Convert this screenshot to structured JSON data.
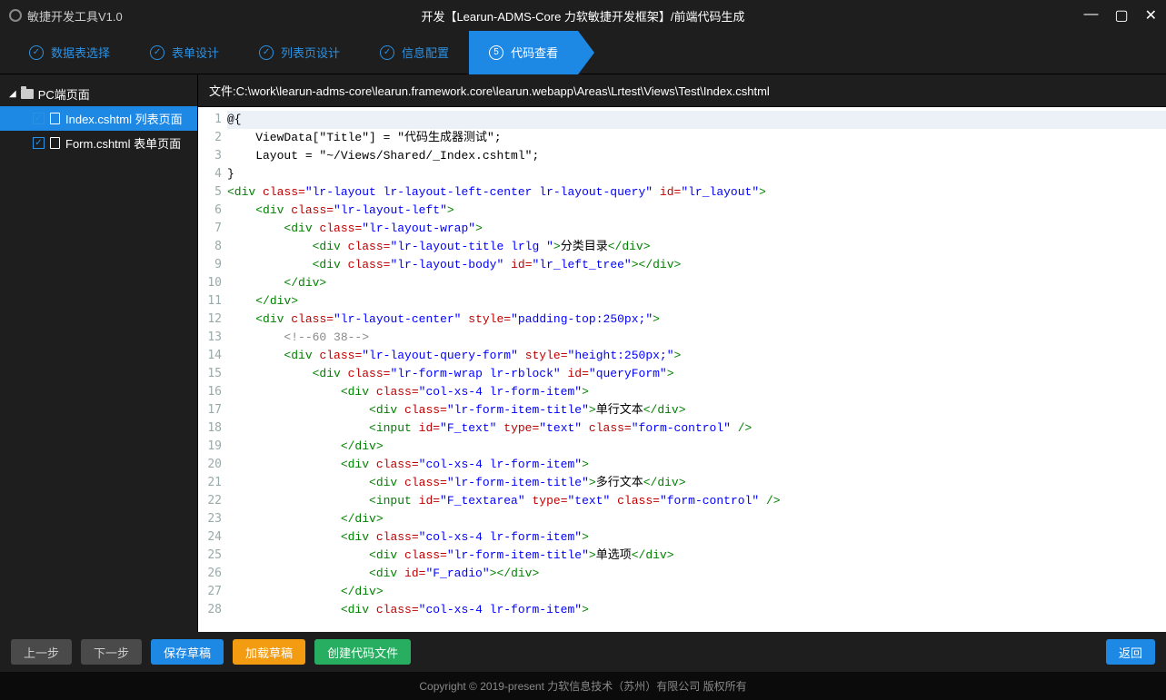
{
  "app": {
    "name": "敏捷开发工具V1.0"
  },
  "window": {
    "title": "开发【Learun-ADMS-Core 力软敏捷开发框架】/前端代码生成"
  },
  "steps": [
    {
      "num": "✓",
      "label": "数据表选择"
    },
    {
      "num": "✓",
      "label": "表单设计"
    },
    {
      "num": "✓",
      "label": "列表页设计"
    },
    {
      "num": "✓",
      "label": "信息配置"
    },
    {
      "num": "⑤",
      "label": "代码查看",
      "active": true
    }
  ],
  "tree": {
    "root": "PC端页面",
    "items": [
      {
        "label": "Index.cshtml 列表页面",
        "selected": true
      },
      {
        "label": "Form.cshtml 表单页面",
        "selected": false
      }
    ]
  },
  "filepath_label": "文件:",
  "filepath": "C:\\work\\learun-adms-core\\learun.framework.core\\learun.webapp\\Areas\\Lrtest\\Views\\Test\\Index.cshtml",
  "code_lines": [
    {
      "n": 1,
      "hl": true,
      "raw": "@{"
    },
    {
      "n": 2,
      "raw": "    ViewData[\"Title\"] = \"代码生成器测试\";"
    },
    {
      "n": 3,
      "raw": "    Layout = \"~/Views/Shared/_Index.cshtml\";"
    },
    {
      "n": 4,
      "raw": "}"
    },
    {
      "n": 5,
      "tokens": [
        [
          "tag",
          "<div "
        ],
        [
          "attr",
          "class="
        ],
        [
          "val",
          "\"lr-layout lr-layout-left-center lr-layout-query\""
        ],
        [
          "txt",
          " "
        ],
        [
          "attr",
          "id="
        ],
        [
          "val",
          "\"lr_layout\""
        ],
        [
          "tag",
          ">"
        ]
      ]
    },
    {
      "n": 6,
      "tokens": [
        [
          "txt",
          "    "
        ],
        [
          "tag",
          "<div "
        ],
        [
          "attr",
          "class="
        ],
        [
          "val",
          "\"lr-layout-left\""
        ],
        [
          "tag",
          ">"
        ]
      ]
    },
    {
      "n": 7,
      "tokens": [
        [
          "txt",
          "        "
        ],
        [
          "tag",
          "<div "
        ],
        [
          "attr",
          "class="
        ],
        [
          "val",
          "\"lr-layout-wrap\""
        ],
        [
          "tag",
          ">"
        ]
      ]
    },
    {
      "n": 8,
      "tokens": [
        [
          "txt",
          "            "
        ],
        [
          "tag",
          "<div "
        ],
        [
          "attr",
          "class="
        ],
        [
          "val",
          "\"lr-layout-title lrlg \""
        ],
        [
          "tag",
          ">"
        ],
        [
          "txt",
          "分类目录"
        ],
        [
          "tag",
          "</div>"
        ]
      ]
    },
    {
      "n": 9,
      "tokens": [
        [
          "txt",
          "            "
        ],
        [
          "tag",
          "<div "
        ],
        [
          "attr",
          "class="
        ],
        [
          "val",
          "\"lr-layout-body\""
        ],
        [
          "txt",
          " "
        ],
        [
          "attr",
          "id="
        ],
        [
          "val",
          "\"lr_left_tree\""
        ],
        [
          "tag",
          "></div>"
        ]
      ]
    },
    {
      "n": 10,
      "tokens": [
        [
          "txt",
          "        "
        ],
        [
          "tag",
          "</div>"
        ]
      ]
    },
    {
      "n": 11,
      "tokens": [
        [
          "txt",
          "    "
        ],
        [
          "tag",
          "</div>"
        ]
      ]
    },
    {
      "n": 12,
      "tokens": [
        [
          "txt",
          "    "
        ],
        [
          "tag",
          "<div "
        ],
        [
          "attr",
          "class="
        ],
        [
          "val",
          "\"lr-layout-center\""
        ],
        [
          "txt",
          " "
        ],
        [
          "attr",
          "style="
        ],
        [
          "val",
          "\"padding-top:250px;\""
        ],
        [
          "tag",
          ">"
        ]
      ]
    },
    {
      "n": 13,
      "tokens": [
        [
          "txt",
          "        "
        ],
        [
          "cmt",
          "<!--60 38-->"
        ]
      ]
    },
    {
      "n": 14,
      "tokens": [
        [
          "txt",
          "        "
        ],
        [
          "tag",
          "<div "
        ],
        [
          "attr",
          "class="
        ],
        [
          "val",
          "\"lr-layout-query-form\""
        ],
        [
          "txt",
          " "
        ],
        [
          "attr",
          "style="
        ],
        [
          "val",
          "\"height:250px;\""
        ],
        [
          "tag",
          ">"
        ]
      ]
    },
    {
      "n": 15,
      "tokens": [
        [
          "txt",
          "            "
        ],
        [
          "tag",
          "<div "
        ],
        [
          "attr",
          "class="
        ],
        [
          "val",
          "\"lr-form-wrap lr-rblock\""
        ],
        [
          "txt",
          " "
        ],
        [
          "attr",
          "id="
        ],
        [
          "val",
          "\"queryForm\""
        ],
        [
          "tag",
          ">"
        ]
      ]
    },
    {
      "n": 16,
      "tokens": [
        [
          "txt",
          "                "
        ],
        [
          "tag",
          "<div "
        ],
        [
          "attr",
          "class="
        ],
        [
          "val",
          "\"col-xs-4 lr-form-item\""
        ],
        [
          "tag",
          ">"
        ]
      ]
    },
    {
      "n": 17,
      "tokens": [
        [
          "txt",
          "                    "
        ],
        [
          "tag",
          "<div "
        ],
        [
          "attr",
          "class="
        ],
        [
          "val",
          "\"lr-form-item-title\""
        ],
        [
          "tag",
          ">"
        ],
        [
          "txt",
          "单行文本"
        ],
        [
          "tag",
          "</div>"
        ]
      ]
    },
    {
      "n": 18,
      "tokens": [
        [
          "txt",
          "                    "
        ],
        [
          "tag",
          "<input "
        ],
        [
          "attr",
          "id="
        ],
        [
          "val",
          "\"F_text\""
        ],
        [
          "txt",
          " "
        ],
        [
          "attr",
          "type="
        ],
        [
          "val",
          "\"text\""
        ],
        [
          "txt",
          " "
        ],
        [
          "attr",
          "class="
        ],
        [
          "val",
          "\"form-control\""
        ],
        [
          "tag",
          " />"
        ]
      ]
    },
    {
      "n": 19,
      "tokens": [
        [
          "txt",
          "                "
        ],
        [
          "tag",
          "</div>"
        ]
      ]
    },
    {
      "n": 20,
      "tokens": [
        [
          "txt",
          "                "
        ],
        [
          "tag",
          "<div "
        ],
        [
          "attr",
          "class="
        ],
        [
          "val",
          "\"col-xs-4 lr-form-item\""
        ],
        [
          "tag",
          ">"
        ]
      ]
    },
    {
      "n": 21,
      "tokens": [
        [
          "txt",
          "                    "
        ],
        [
          "tag",
          "<div "
        ],
        [
          "attr",
          "class="
        ],
        [
          "val",
          "\"lr-form-item-title\""
        ],
        [
          "tag",
          ">"
        ],
        [
          "txt",
          "多行文本"
        ],
        [
          "tag",
          "</div>"
        ]
      ]
    },
    {
      "n": 22,
      "tokens": [
        [
          "txt",
          "                    "
        ],
        [
          "tag",
          "<input "
        ],
        [
          "attr",
          "id="
        ],
        [
          "val",
          "\"F_textarea\""
        ],
        [
          "txt",
          " "
        ],
        [
          "attr",
          "type="
        ],
        [
          "val",
          "\"text\""
        ],
        [
          "txt",
          " "
        ],
        [
          "attr",
          "class="
        ],
        [
          "val",
          "\"form-control\""
        ],
        [
          "tag",
          " />"
        ]
      ]
    },
    {
      "n": 23,
      "tokens": [
        [
          "txt",
          "                "
        ],
        [
          "tag",
          "</div>"
        ]
      ]
    },
    {
      "n": 24,
      "tokens": [
        [
          "txt",
          "                "
        ],
        [
          "tag",
          "<div "
        ],
        [
          "attr",
          "class="
        ],
        [
          "val",
          "\"col-xs-4 lr-form-item\""
        ],
        [
          "tag",
          ">"
        ]
      ]
    },
    {
      "n": 25,
      "tokens": [
        [
          "txt",
          "                    "
        ],
        [
          "tag",
          "<div "
        ],
        [
          "attr",
          "class="
        ],
        [
          "val",
          "\"lr-form-item-title\""
        ],
        [
          "tag",
          ">"
        ],
        [
          "txt",
          "单选项"
        ],
        [
          "tag",
          "</div>"
        ]
      ]
    },
    {
      "n": 26,
      "tokens": [
        [
          "txt",
          "                    "
        ],
        [
          "tag",
          "<div "
        ],
        [
          "attr",
          "id="
        ],
        [
          "val",
          "\"F_radio\""
        ],
        [
          "tag",
          "></div>"
        ]
      ]
    },
    {
      "n": 27,
      "tokens": [
        [
          "txt",
          "                "
        ],
        [
          "tag",
          "</div>"
        ]
      ]
    },
    {
      "n": 28,
      "tokens": [
        [
          "txt",
          "                "
        ],
        [
          "tag",
          "<div "
        ],
        [
          "attr",
          "class="
        ],
        [
          "val",
          "\"col-xs-4 lr-form-item\""
        ],
        [
          "tag",
          ">"
        ]
      ]
    }
  ],
  "buttons": {
    "prev": "上一步",
    "next": "下一步",
    "save_draft": "保存草稿",
    "load_draft": "加载草稿",
    "create_file": "创建代码文件",
    "back": "返回"
  },
  "copyright": "Copyright © 2019-present 力软信息技术（苏州）有限公司 版权所有"
}
